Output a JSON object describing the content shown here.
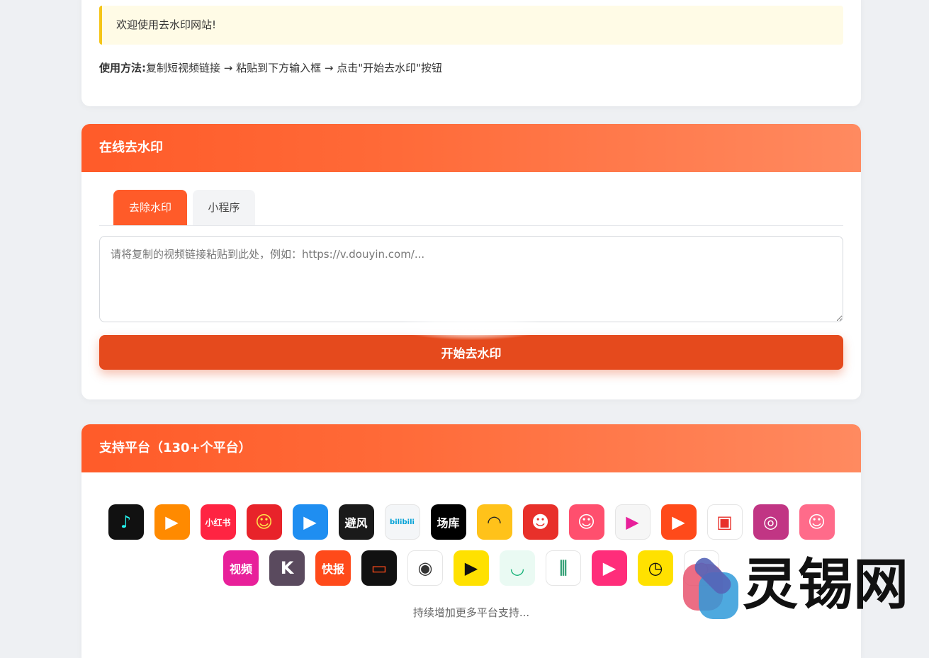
{
  "notice": {
    "welcome": "欢迎使用去水印网站!",
    "usage_label": "使用方法:",
    "usage_text": "复制短视频链接 → 粘贴到下方输入框 → 点击\"开始去水印\"按钮"
  },
  "main": {
    "title": "在线去水印",
    "tabs": [
      {
        "label": "去除水印",
        "active": true
      },
      {
        "label": "小程序",
        "active": false
      }
    ],
    "input": {
      "placeholder": "请将复制的视频链接粘贴到此处，例如：https://v.douyin.com/...",
      "value": ""
    },
    "start_button": "开始去水印"
  },
  "platforms": {
    "title": "支持平台（130+个平台）",
    "more_text": "持续增加更多平台支持...",
    "row1": [
      {
        "icon": "tiktok-icon",
        "glyph": "♪",
        "bg": "#111111",
        "fg": "#25f4ee"
      },
      {
        "icon": "kuaishou-icon",
        "glyph": "▶",
        "bg": "#ff8a00",
        "fg": "#ffffff"
      },
      {
        "icon": "xiaohongshu-icon",
        "glyph": "小红书",
        "bg": "#ff2442",
        "fg": "#ffffff"
      },
      {
        "icon": "anime-girl-icon",
        "glyph": "☺",
        "bg": "#e8232a",
        "fg": "#ffe14a"
      },
      {
        "icon": "video-play-icon",
        "glyph": "▶",
        "bg": "#1f8ef1",
        "fg": "#ffffff"
      },
      {
        "icon": "bifeng-icon",
        "glyph": "避风",
        "bg": "#1a1a1a",
        "fg": "#ffffff"
      },
      {
        "icon": "bilibili-icon",
        "glyph": "bilibili",
        "bg": "#f4f6f8",
        "fg": "#00a1d6"
      },
      {
        "icon": "changku-icon",
        "glyph": "场库",
        "bg": "#000000",
        "fg": "#ffffff"
      },
      {
        "icon": "helmet-icon",
        "glyph": "◠",
        "bg": "#ffc21a",
        "fg": "#222222"
      },
      {
        "icon": "monkey-icon",
        "glyph": "☻",
        "bg": "#e8302a",
        "fg": "#ffffff"
      },
      {
        "icon": "cartoon-boy-icon",
        "glyph": "☺",
        "bg": "#ff4f6e",
        "fg": "#ffffff"
      },
      {
        "icon": "colorful-play-icon",
        "glyph": "▶",
        "bg": "#f6f6f6",
        "fg": "#e8209a"
      },
      {
        "icon": "flame-video-icon",
        "glyph": "▶",
        "bg": "#ff4a1a",
        "fg": "#ffffff"
      },
      {
        "icon": "grid-play-icon",
        "glyph": "▣",
        "bg": "#ffffff",
        "fg": "#e8302a"
      },
      {
        "icon": "instagram-icon",
        "glyph": "◎",
        "bg": "#c13584",
        "fg": "#ffffff"
      },
      {
        "icon": "laughing-face-icon",
        "glyph": "☺",
        "bg": "#ff6b8a",
        "fg": "#ffffff"
      }
    ],
    "row2": [
      {
        "icon": "tencent-video-icon",
        "glyph": "视频",
        "bg": "#e8209a",
        "fg": "#ffffff"
      },
      {
        "icon": "k-letter-icon",
        "glyph": "K",
        "bg": "#5a4a5e",
        "fg": "#ffffff"
      },
      {
        "icon": "kuaibao-icon",
        "glyph": "快报",
        "bg": "#ff4a1a",
        "fg": "#ffffff"
      },
      {
        "icon": "screen-record-icon",
        "glyph": "▭",
        "bg": "#111111",
        "fg": "#ff4a1a"
      },
      {
        "icon": "eye-icon",
        "glyph": "◉",
        "bg": "#ffffff",
        "fg": "#333333"
      },
      {
        "icon": "pear-video-icon",
        "glyph": "▶",
        "bg": "#ffe100",
        "fg": "#111111"
      },
      {
        "icon": "bowl-icon",
        "glyph": "◡",
        "bg": "#eafaf3",
        "fg": "#19b37a"
      },
      {
        "icon": "bamboo-icon",
        "glyph": "⫼",
        "bg": "#ffffff",
        "fg": "#3aa37a"
      },
      {
        "icon": "camera-video-icon",
        "glyph": "▶",
        "bg": "#ff2d7a",
        "fg": "#ffffff"
      },
      {
        "icon": "stopwatch-play-icon",
        "glyph": "◷",
        "bg": "#ffe100",
        "fg": "#111111"
      },
      {
        "icon": "ring-logo-icon",
        "glyph": "○",
        "bg": "#ffffff",
        "fg": "#ff3d8b"
      }
    ]
  },
  "watermark": {
    "text": "灵锡网"
  }
}
